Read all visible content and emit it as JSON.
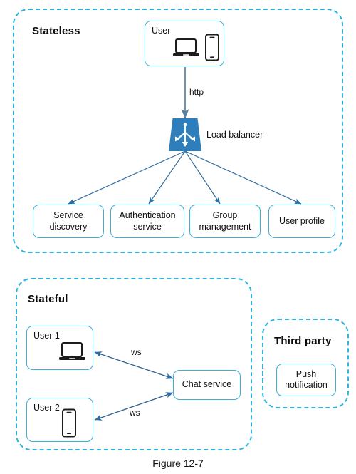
{
  "figure": {
    "caption": "Figure 12-7"
  },
  "groups": [
    {
      "id": "stateless",
      "title": "Stateless"
    },
    {
      "id": "stateful",
      "title": "Stateful"
    },
    {
      "id": "third_party",
      "title": "Third party"
    }
  ],
  "stateless": {
    "user_box": {
      "label": "User",
      "icons": [
        "laptop-icon",
        "phone-icon"
      ]
    },
    "connection": {
      "label": "http",
      "from": "User",
      "to": "Load balancer",
      "direction": "one-way"
    },
    "load_balancer": {
      "label": "Load balancer",
      "icon": "load-balancer-icon",
      "color": "#2E7EBB"
    },
    "services": [
      {
        "id": "service-discovery",
        "line1": "Service",
        "line2": "discovery"
      },
      {
        "id": "authentication-service",
        "line1": "Authentication",
        "line2": "service"
      },
      {
        "id": "group-management",
        "line1": "Group",
        "line2": "management"
      },
      {
        "id": "user-profile",
        "line1": "User profile",
        "line2": ""
      }
    ]
  },
  "stateful": {
    "users": [
      {
        "id": "user-1",
        "label": "User 1",
        "icon": "laptop-icon"
      },
      {
        "id": "user-2",
        "label": "User 2",
        "icon": "phone-icon"
      }
    ],
    "chat_service": {
      "label": "Chat service"
    },
    "connections": [
      {
        "label": "ws",
        "from": "User 1",
        "to": "Chat service",
        "direction": "two-way"
      },
      {
        "label": "ws",
        "from": "User 2",
        "to": "Chat service",
        "direction": "two-way"
      }
    ]
  },
  "third_party": {
    "nodes": [
      {
        "id": "push-notification",
        "line1": "Push",
        "line2": "notification"
      }
    ]
  },
  "colors": {
    "dashed_border": "#2FB4DE",
    "node_border": "#3BAFD4",
    "arrow": "#2E6DA4",
    "load_balancer_fill": "#2E7EBB",
    "text": "#111111",
    "background": "#FFFFFF"
  }
}
